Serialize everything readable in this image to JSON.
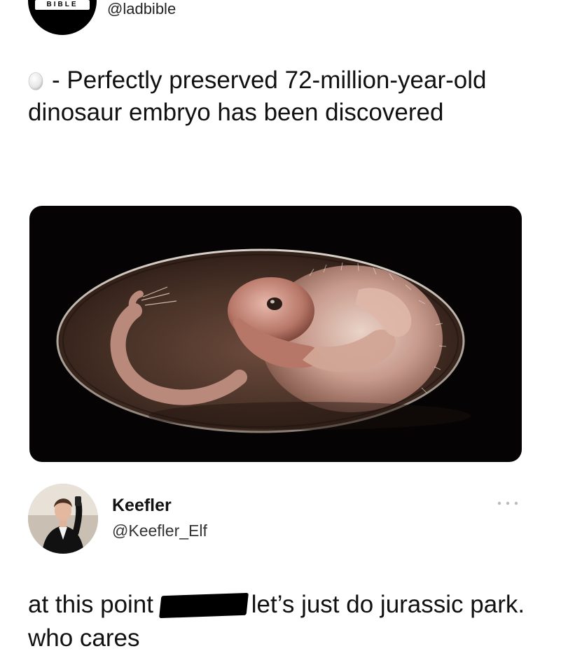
{
  "top_tweet": {
    "avatar_badge": "BIBLE",
    "handle": "@ladbible",
    "emoji_name": "egg-icon",
    "text": "- Perfectly preserved 72-million-year-old dinosaur embryo has been discovered",
    "media_name": "dinosaur-embryo-photo"
  },
  "reply": {
    "name": "Keefler",
    "handle": "@Keefler_Elf",
    "more_icon": "more-options-icon",
    "text_before": "at this point",
    "text_after": "let’s just do jurassic park. who cares"
  },
  "colors": {
    "text": "#111111",
    "media_background": "#050303",
    "egg_interior": "#4a3328",
    "embryo_skin": "#c79a8c"
  }
}
